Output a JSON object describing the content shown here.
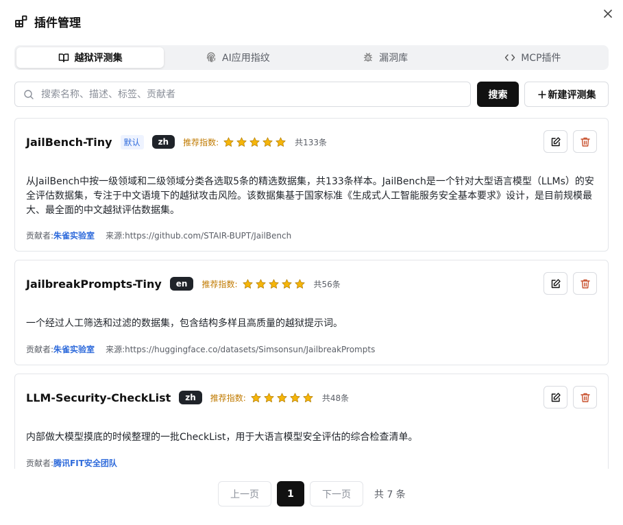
{
  "modal": {
    "title": "插件管理"
  },
  "tabs": [
    {
      "label": "越狱评测集",
      "icon": "book-icon",
      "active": true
    },
    {
      "label": "AI应用指纹",
      "icon": "fingerprint-icon",
      "active": false
    },
    {
      "label": "漏洞库",
      "icon": "bug-icon",
      "active": false
    },
    {
      "label": "MCP插件",
      "icon": "code-icon",
      "active": false
    }
  ],
  "search": {
    "placeholder": "搜索名称、描述、标签、贡献者",
    "value": "",
    "button_label": "搜索"
  },
  "new_button": {
    "label": "新建评测集"
  },
  "cards": [
    {
      "name": "JailBench-Tiny",
      "default_badge": "默认",
      "lang": "zh",
      "rec_label": "推荐指数:",
      "rating": 5,
      "count": "共133条",
      "description": "从JailBench中按一级领域和二级领域分类各选取5条的精选数据集，共133条样本。JailBench是一个针对大型语言模型（LLMs）的安全评估数据集，专注于中文语境下的越狱攻击风险。该数据集基于国家标准《生成式人工智能服务安全基本要求》设计，是目前规模最大、最全面的中文越狱评估数据集。",
      "contributor_label": "贡献者:",
      "contributor": "朱雀实验室",
      "source_label": "来源:",
      "source": "https://github.com/STAIR-BUPT/JailBench"
    },
    {
      "name": "JailbreakPrompts-Tiny",
      "default_badge": "",
      "lang": "en",
      "rec_label": "推荐指数:",
      "rating": 5,
      "count": "共56条",
      "description": "一个经过人工筛选和过滤的数据集，包含结构多样且高质量的越狱提示词。",
      "contributor_label": "贡献者:",
      "contributor": "朱雀实验室",
      "source_label": "来源:",
      "source": "https://huggingface.co/datasets/Simsonsun/JailbreakPrompts"
    },
    {
      "name": "LLM-Security-CheckList",
      "default_badge": "",
      "lang": "zh",
      "rec_label": "推荐指数:",
      "rating": 5,
      "count": "共48条",
      "description": "内部做大模型摸底的时候整理的一批CheckList，用于大语言模型安全评估的综合检查清单。",
      "contributor_label": "贡献者:",
      "contributor": "腾讯FIT安全团队",
      "source_label": "",
      "source": ""
    }
  ],
  "pagination": {
    "prev": "上一页",
    "current": "1",
    "next": "下一页",
    "total": "共 7 条"
  },
  "colors": {
    "accent": "#111111",
    "link": "#2f6bdb",
    "star": "#f5b50a",
    "delete": "#c8502d"
  }
}
